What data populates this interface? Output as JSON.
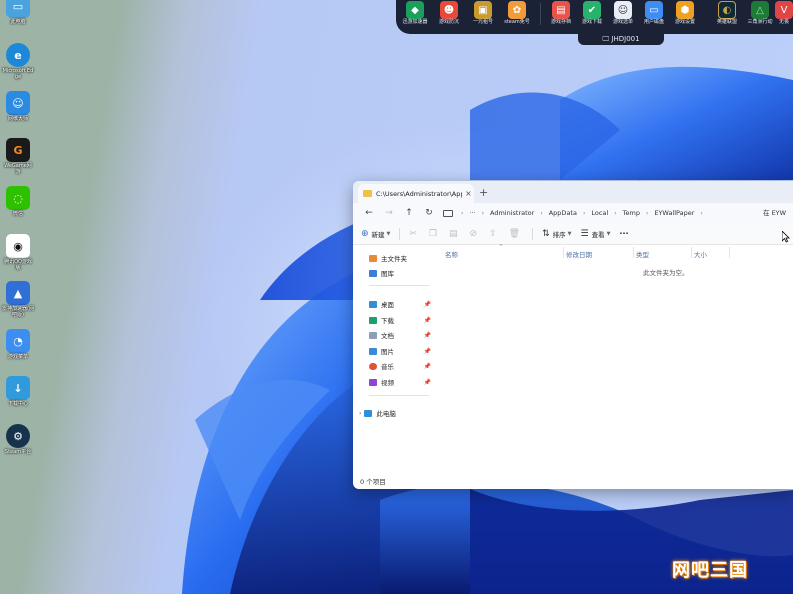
{
  "desktop_icons": [
    {
      "label": "此电脑",
      "icon": "computer-icon",
      "color": "#4aa3df"
    },
    {
      "label": "Microsoft Edge",
      "icon": "edge-icon",
      "color": "#1e88d8"
    },
    {
      "label": "网维大师",
      "icon": "robot-icon",
      "color": "#2a8be0"
    },
    {
      "label": "WeGame网游",
      "icon": "wegame-icon",
      "color": "#1a1a1a"
    },
    {
      "label": "微信",
      "icon": "wechat-icon",
      "color": "#2dc100"
    },
    {
      "label": "腾讯QQ游戏版",
      "icon": "qq-icon",
      "color": "#111111"
    },
    {
      "label": "雷神加速器(网吧版)",
      "icon": "accelerator-icon",
      "color": "#2f6fd6"
    },
    {
      "label": "游戏菜单",
      "icon": "game-menu-icon",
      "color": "#3c8ef0"
    },
    {
      "label": "下载中心",
      "icon": "download-center-icon",
      "color": "#2f9bdc"
    },
    {
      "label": "Steam平台",
      "icon": "steam-icon",
      "color": "#17324d"
    }
  ],
  "topbar": {
    "items": [
      {
        "label": "迅游加速器",
        "icon": "xunyou-icon",
        "color": "#1aa05a"
      },
      {
        "label": "游戏防沉",
        "icon": "game-shield-icon",
        "color": "#e84a3a"
      },
      {
        "label": "一元租号",
        "icon": "rent-account-icon",
        "color": "#c99a2e"
      },
      {
        "label": "steam免号",
        "icon": "steam-free-icon",
        "color": "#f29b3b"
      },
      {
        "label": "游戏存档",
        "icon": "game-save-icon",
        "color": "#e8534a"
      },
      {
        "label": "游戏下载",
        "icon": "game-download-icon",
        "color": "#27b36b"
      },
      {
        "label": "游戏选单",
        "icon": "game-select-icon",
        "color": "#e9eef6"
      },
      {
        "label": "用户磁盘",
        "icon": "user-disk-icon",
        "color": "#3f8cf2"
      },
      {
        "label": "游戏设置",
        "icon": "game-settings-icon",
        "color": "#f0a020"
      },
      {
        "label": "英雄联盟",
        "icon": "lol-icon",
        "color": "#0f2a33"
      },
      {
        "label": "三角洲行动",
        "icon": "delta-force-icon",
        "color": "#1f7a3a"
      },
      {
        "label": "无畏",
        "icon": "valorant-icon",
        "color": "#e04545"
      }
    ],
    "machine_name": "JHDJ001"
  },
  "explorer": {
    "tab_title": "C:\\Users\\Administrator\\AppData",
    "new_tab": "+",
    "breadcrumb": [
      "Administrator",
      "AppData",
      "Local",
      "Temp",
      "EYWallPaper"
    ],
    "search_placeholder": "在 EYW",
    "toolbar": {
      "new_label": "新建",
      "sort_label": "排序",
      "view_label": "查看",
      "more_label": "···"
    },
    "sidebar": {
      "top": [
        {
          "label": "主文件夹",
          "icon": "home-icon",
          "color": "#e58b3a"
        },
        {
          "label": "图库",
          "icon": "gallery-icon",
          "color": "#3b7dd8"
        }
      ],
      "pinned": [
        {
          "label": "桌面",
          "icon": "desktop-icon",
          "color": "#2f8fd8"
        },
        {
          "label": "下载",
          "icon": "download-icon",
          "color": "#1e9e6a"
        },
        {
          "label": "文档",
          "icon": "documents-icon",
          "color": "#8aa0b8"
        },
        {
          "label": "图片",
          "icon": "pictures-icon",
          "color": "#3a8ad8"
        },
        {
          "label": "音乐",
          "icon": "music-icon",
          "color": "#e0533a"
        },
        {
          "label": "视频",
          "icon": "videos-icon",
          "color": "#8b48d6"
        }
      ],
      "this_pc": {
        "label": "此电脑",
        "icon": "this-pc-icon",
        "color": "#2f8fd8"
      }
    },
    "columns": [
      "名称",
      "修改日期",
      "类型",
      "大小"
    ],
    "empty_message": "此文件夹为空。",
    "status": "0 个项目"
  },
  "watermark": "网吧三国"
}
